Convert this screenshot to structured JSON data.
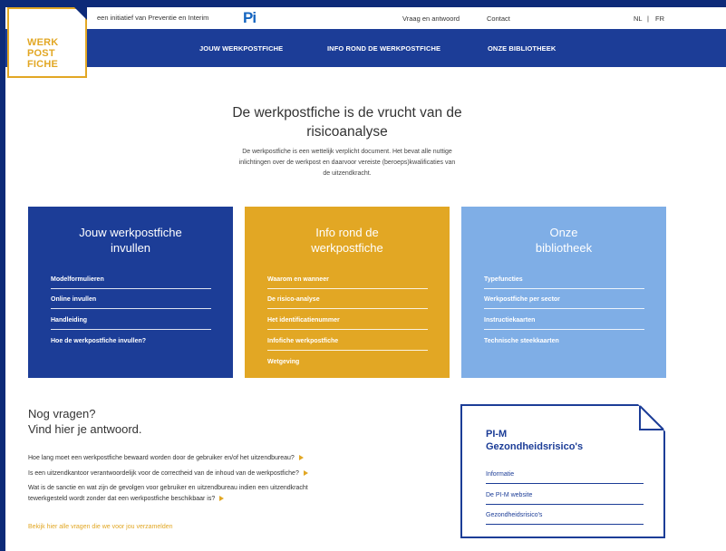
{
  "topbar": {
    "initiative": "een initiatief van Preventie en Interim",
    "pi_logo": "Pi",
    "links": [
      "Vraag en antwoord",
      "Contact"
    ],
    "lang_nl": "NL",
    "lang_sep": "|",
    "lang_fr": "FR"
  },
  "logo": {
    "lines": [
      "WERK",
      "POST",
      "FICHE"
    ]
  },
  "nav": [
    "JOUW WERKPOSTFICHE",
    "INFO ROND DE WERKPOSTFICHE",
    "ONZE BIBLIOTHEEK"
  ],
  "intro": {
    "title_line1": "De werkpostfiche is de vrucht van de",
    "title_line2": "risicoanalyse",
    "text_line1": "De werkpostfiche is een wettelijk verplicht document. Het bevat alle nuttige",
    "text_line2": "inlichtingen over de werkpost en daarvoor vereiste (beroeps)kwalificaties van",
    "text_line3": "de uitzendkracht."
  },
  "cards": [
    {
      "title_line1": "Jouw werkpostfiche",
      "title_line2": "invullen",
      "color": "#1c3d97",
      "links": [
        "Modelformulieren",
        "Online invullen",
        "Handleiding",
        "Hoe de werkpostfiche invullen?"
      ]
    },
    {
      "title_line1": "Info rond de",
      "title_line2": "werkpostfiche",
      "color": "#e2a724",
      "links": [
        "Waarom en wanneer",
        "De risico-analyse",
        "Het identificatienummer",
        "Infofiche werkpostfiche",
        "Wetgeving"
      ]
    },
    {
      "title_line1": "Onze",
      "title_line2": "bibliotheek",
      "color": "#7faee6",
      "links": [
        "Typefuncties",
        "Werkpostfiche per sector",
        "Instructiekaarten",
        "Technische steekkaarten"
      ]
    }
  ],
  "questions": {
    "title_line1": "Nog vragen?",
    "title_line2": "Vind hier je antwoord.",
    "items": [
      "Hoe lang moet een werkpostfiche bewaard worden door de gebruiker en/of het uitzendbureau?",
      "Is een uitzendkantoor verantwoordelijk voor de correctheid van de inhoud van de werkpostfiche?"
    ],
    "item3_line1": "Wat is de sanctie en wat zijn de gevolgen voor gebruiker en uitzendbureau indien een uitzendkracht",
    "item3_line2": "tewerkgesteld wordt zonder dat een werkpostfiche beschikbaar is?",
    "all_link": "Bekijk hier alle vragen die we voor jou verzamelden"
  },
  "pim": {
    "title_line1": "PI-M",
    "title_line2": "Gezondheidsrisico's",
    "links": [
      "Informatie",
      "De PI-M website",
      "Gezondheidsrisico's"
    ]
  }
}
